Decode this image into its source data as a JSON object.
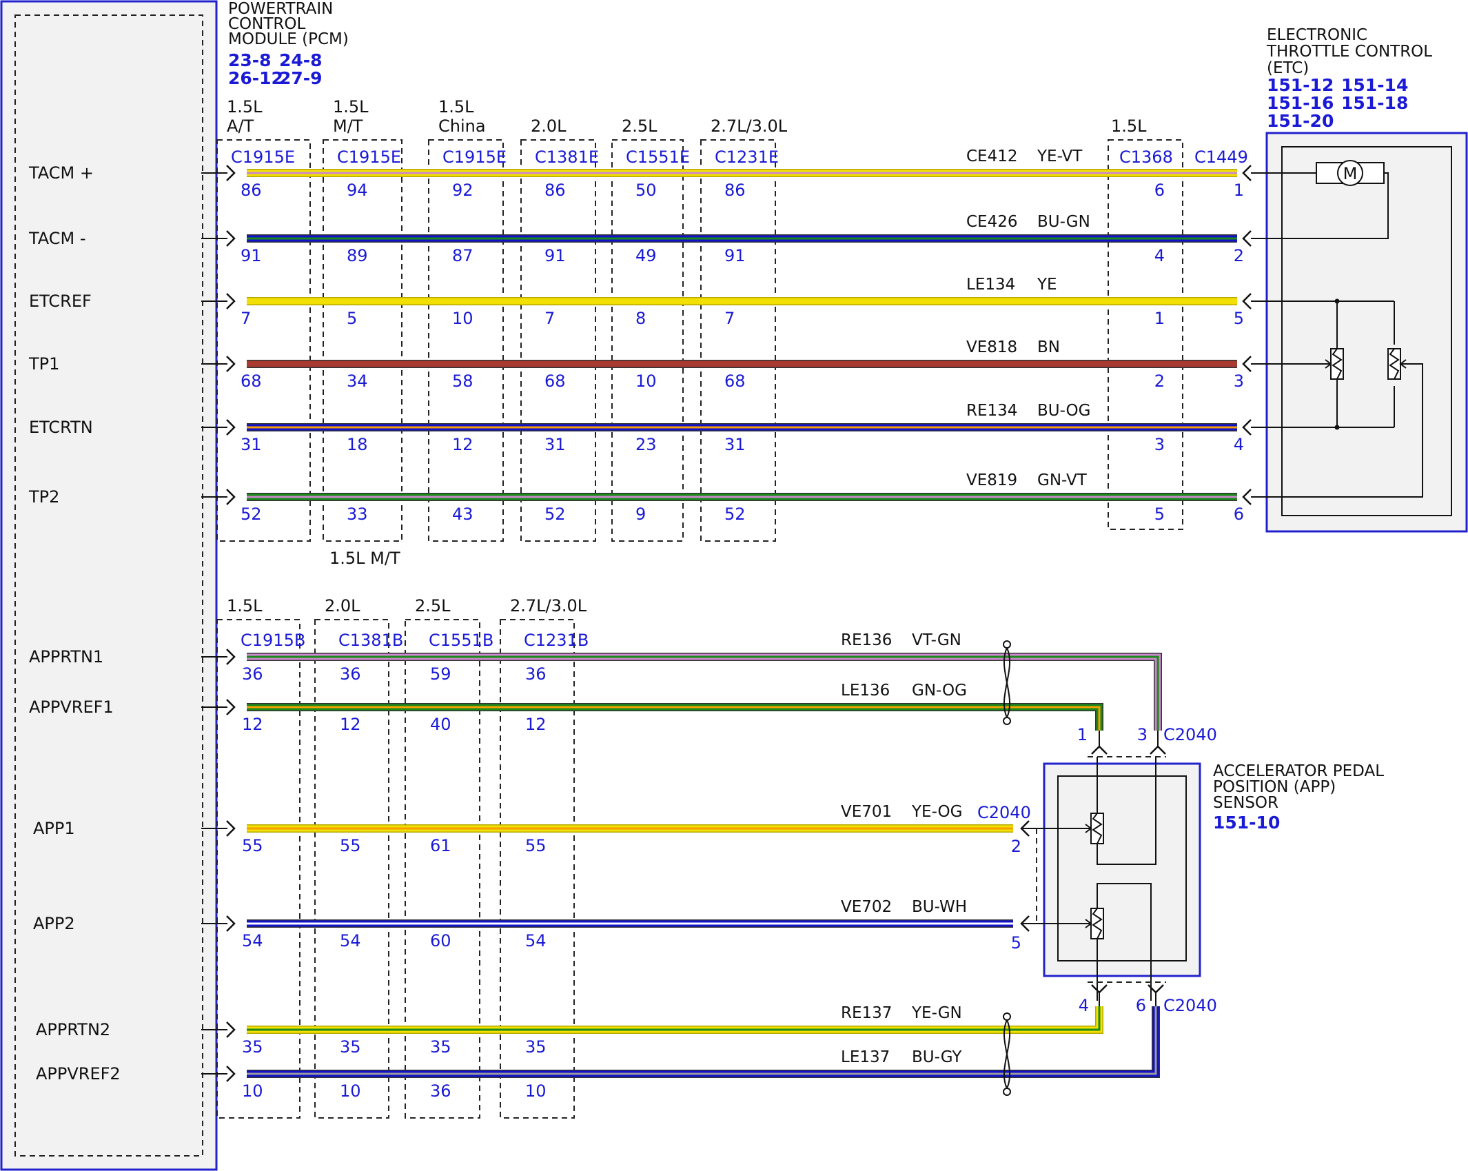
{
  "colors": {
    "ye": "#f2e000",
    "ye_edge": "#b8a800",
    "bu": "#1111cc",
    "gn": "#1a8a1a",
    "bn": "#a83a32",
    "vt": "#cc88cc",
    "og": "#f5a000",
    "wh": "#ffffff",
    "gy": "#9a9a9a",
    "module_border": "#2222cc",
    "module_fill": "#f2f2f2"
  },
  "pcm": {
    "title_lines": [
      "POWERTRAIN",
      "CONTROL",
      "MODULE (PCM)"
    ],
    "refs": [
      "23-8",
      "24-8",
      "26-12",
      "27-9"
    ]
  },
  "etc": {
    "title_lines": [
      "ELECTRONIC",
      "THROTTLE CONTROL",
      "(ETC)"
    ],
    "refs": [
      "151-12",
      "151-14",
      "151-16",
      "151-18",
      "151-20"
    ],
    "motor_symbol": "M"
  },
  "app": {
    "title_lines": [
      "ACCELERATOR PEDAL",
      "POSITION (APP)",
      "SENSOR"
    ],
    "ref": "151-10",
    "connector": "C2040"
  },
  "top_groups": [
    {
      "variant": [
        "1.5L",
        "A/T"
      ],
      "connector": "C1915E"
    },
    {
      "variant": [
        "1.5L",
        "M/T"
      ],
      "connector": "C1915E"
    },
    {
      "variant": [
        "1.5L",
        "China"
      ],
      "connector": "C1915E"
    },
    {
      "variant": [
        "2.0L"
      ],
      "connector": "C1381E"
    },
    {
      "variant": [
        "2.5L"
      ],
      "connector": "C1551E"
    },
    {
      "variant": [
        "2.7L/3.0L"
      ],
      "connector": "C1231E"
    }
  ],
  "top_footer": "1.5L M/T",
  "inline_top": {
    "variant": "1.5L",
    "connector": "C1368"
  },
  "etc_connector": "C1449",
  "top_circuits": [
    {
      "signal": "TACM +",
      "circuit": "CE412",
      "color": "YE-VT",
      "pins": [
        "86",
        "94",
        "92",
        "86",
        "50",
        "86"
      ],
      "inline_pin": "6",
      "etc_pin": "1"
    },
    {
      "signal": "TACM -",
      "circuit": "CE426",
      "color": "BU-GN",
      "pins": [
        "91",
        "89",
        "87",
        "91",
        "49",
        "91"
      ],
      "inline_pin": "4",
      "etc_pin": "2"
    },
    {
      "signal": "ETCREF",
      "circuit": "LE134",
      "color": "YE",
      "pins": [
        "7",
        "5",
        "10",
        "7",
        "8",
        "7"
      ],
      "inline_pin": "1",
      "etc_pin": "5"
    },
    {
      "signal": "TP1",
      "circuit": "VE818",
      "color": "BN",
      "pins": [
        "68",
        "34",
        "58",
        "68",
        "10",
        "68"
      ],
      "inline_pin": "2",
      "etc_pin": "3"
    },
    {
      "signal": "ETCRTN",
      "circuit": "RE134",
      "color": "BU-OG",
      "pins": [
        "31",
        "18",
        "12",
        "31",
        "23",
        "31"
      ],
      "inline_pin": "3",
      "etc_pin": "4"
    },
    {
      "signal": "TP2",
      "circuit": "VE819",
      "color": "GN-VT",
      "pins": [
        "52",
        "33",
        "43",
        "52",
        "9",
        "52"
      ],
      "inline_pin": "5",
      "etc_pin": "6"
    }
  ],
  "bottom_groups": [
    {
      "variant": "1.5L",
      "connector": "C1915B"
    },
    {
      "variant": "2.0L",
      "connector": "C1381B"
    },
    {
      "variant": "2.5L",
      "connector": "C1551B"
    },
    {
      "variant": "2.7L/3.0L",
      "connector": "C1231B"
    }
  ],
  "bottom_circuits": [
    {
      "signal": "APPRTN1",
      "circuit": "RE136",
      "color": "VT-GN",
      "pins": [
        "36",
        "36",
        "59",
        "36"
      ],
      "app_pin": "3"
    },
    {
      "signal": "APPVREF1",
      "circuit": "LE136",
      "color": "GN-OG",
      "pins": [
        "12",
        "12",
        "40",
        "12"
      ],
      "app_pin": "1"
    },
    {
      "signal": "APP1",
      "circuit": "VE701",
      "color": "YE-OG",
      "pins": [
        "55",
        "55",
        "61",
        "55"
      ],
      "app_pin": "2"
    },
    {
      "signal": "APP2",
      "circuit": "VE702",
      "color": "BU-WH",
      "pins": [
        "54",
        "54",
        "60",
        "54"
      ],
      "app_pin": "5"
    },
    {
      "signal": "APPRTN2",
      "circuit": "RE137",
      "color": "YE-GN",
      "pins": [
        "35",
        "35",
        "35",
        "35"
      ],
      "app_pin": "4"
    },
    {
      "signal": "APPVREF2",
      "circuit": "LE137",
      "color": "BU-GY",
      "pins": [
        "10",
        "10",
        "36",
        "10"
      ],
      "app_pin": "6"
    }
  ]
}
